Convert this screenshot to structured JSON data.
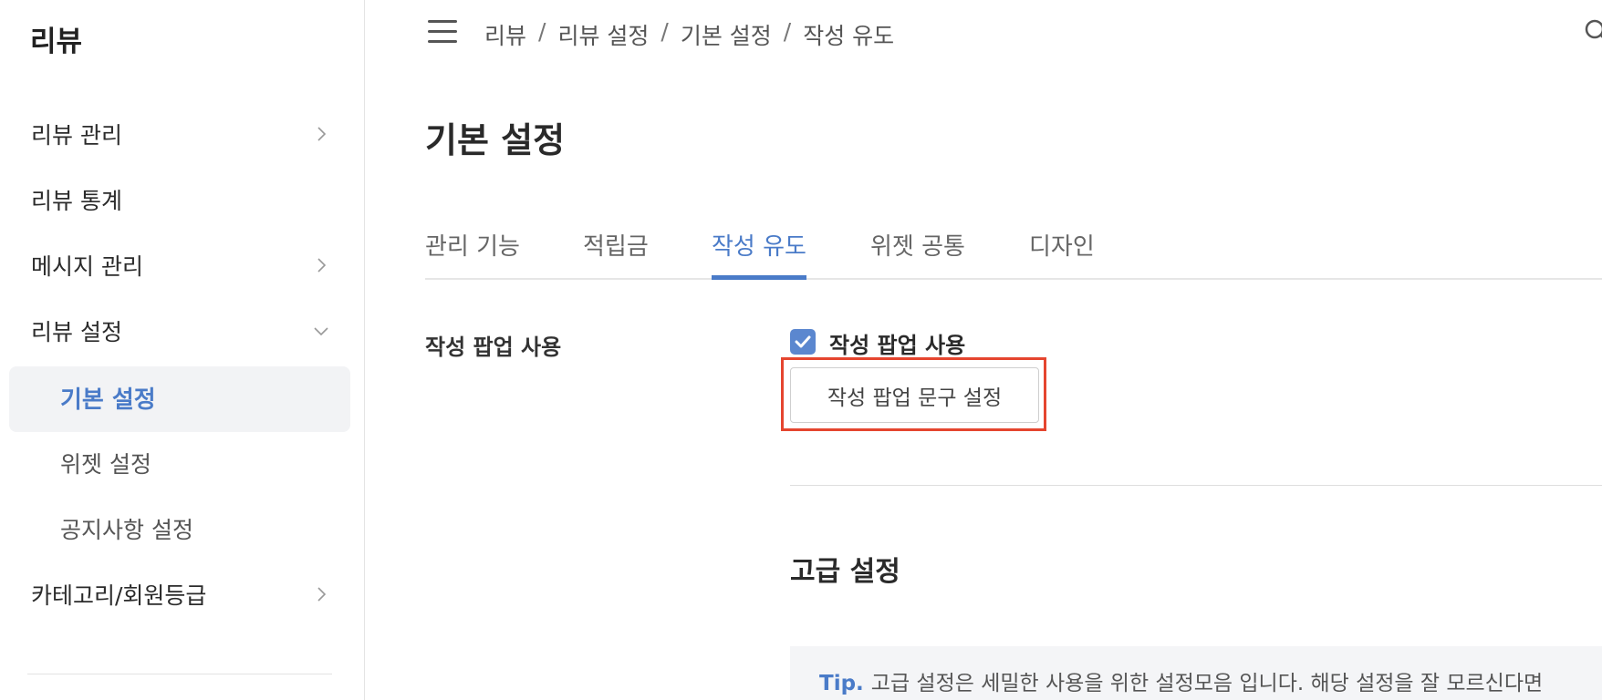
{
  "sidebar": {
    "title": "리뷰",
    "items": [
      {
        "label": "리뷰 관리",
        "icon": "chevron-right-icon"
      },
      {
        "label": "리뷰 통계"
      },
      {
        "label": "메시지 관리",
        "icon": "chevron-right-icon"
      },
      {
        "label": "리뷰 설정",
        "icon": "chevron-down-icon",
        "expanded": true
      },
      {
        "label": "카테고리/회원등급",
        "icon": "chevron-right-icon"
      }
    ],
    "subitems": [
      {
        "label": "기본 설정",
        "active": true
      },
      {
        "label": "위젯 설정"
      },
      {
        "label": "공지사항 설정"
      }
    ]
  },
  "header": {
    "menu_icon": "hamburger-icon",
    "breadcrumb": [
      "리뷰",
      "리뷰 설정",
      "기본 설정",
      "작성 유도"
    ],
    "separator": "/",
    "search_icon": "search-icon"
  },
  "main": {
    "title": "기본 설정",
    "tabs": [
      {
        "label": "관리 기능"
      },
      {
        "label": "적립금"
      },
      {
        "label": "작성 유도",
        "active": true
      },
      {
        "label": "위젯 공통"
      },
      {
        "label": "디자인"
      }
    ],
    "popup_section": {
      "label": "작성 팝업 사용",
      "checkbox_label": "작성 팝업 사용",
      "checked": true,
      "button_label": "작성 팝업 문구 설정"
    },
    "advanced": {
      "title": "고급 설정",
      "tip_label": "Tip.",
      "tip_text": "고급 설정은 세밀한 사용을 위한 설정모음 입니다. 해당 설정을 잘 모르신다면"
    }
  },
  "colors": {
    "accent": "#4a7bc8",
    "highlight": "#e5452f",
    "active_bg": "#f2f3f5"
  }
}
